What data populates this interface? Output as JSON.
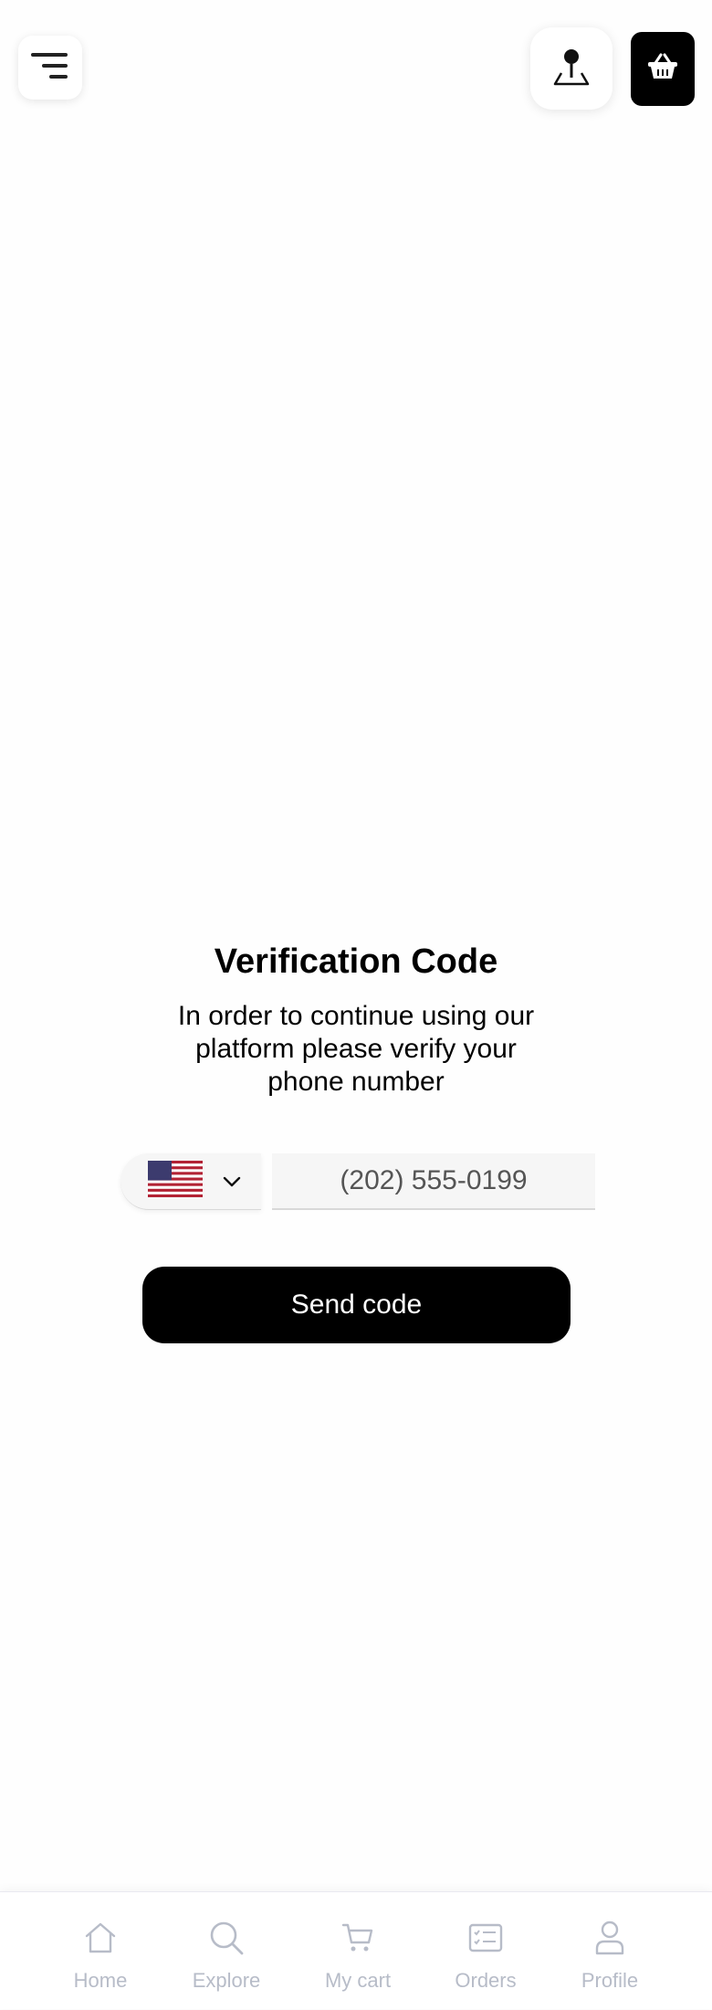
{
  "header": {
    "menu_icon": "menu-lines-icon",
    "location_icon": "map-pin-icon",
    "cart_icon": "basket-icon"
  },
  "verification": {
    "title": "Verification Code",
    "description": "In order to continue using our platform please verify your phone number"
  },
  "phone": {
    "country_flag": "us-flag-icon",
    "placeholder": "(202) 555-0199"
  },
  "actions": {
    "send_label": "Send code"
  },
  "bottom_nav": {
    "items": [
      {
        "label": "Home",
        "icon": "home-icon"
      },
      {
        "label": "Explore",
        "icon": "search-icon"
      },
      {
        "label": "My cart",
        "icon": "cart-icon"
      },
      {
        "label": "Orders",
        "icon": "orders-icon"
      },
      {
        "label": "Profile",
        "icon": "profile-icon"
      }
    ],
    "inactive_color": "#b7bcc8"
  },
  "colors": {
    "primary": "#000000",
    "background": "#fefefe"
  }
}
